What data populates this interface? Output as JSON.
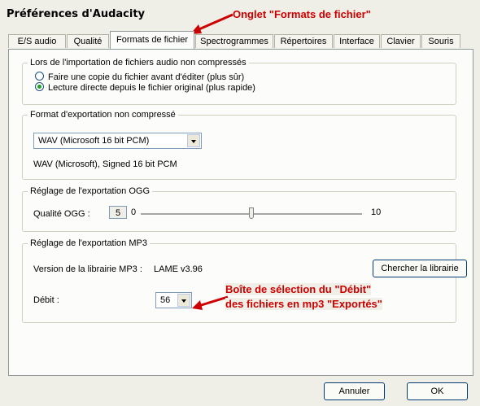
{
  "window": {
    "title": "Préférences d'Audacity"
  },
  "tabs": [
    {
      "label": "E/S audio"
    },
    {
      "label": "Qualité"
    },
    {
      "label": "Formats de fichier"
    },
    {
      "label": "Spectrogrammes"
    },
    {
      "label": "Répertoires"
    },
    {
      "label": "Interface"
    },
    {
      "label": "Clavier"
    },
    {
      "label": "Souris"
    }
  ],
  "active_tab": "Formats de fichier",
  "import_group": {
    "legend": "Lors de l'importation de fichiers audio non compressés",
    "options": [
      {
        "label": "Faire une copie du fichier avant d'éditer (plus sûr)",
        "checked": false
      },
      {
        "label": "Lecture directe depuis le fichier original (plus rapide)",
        "checked": true
      }
    ]
  },
  "export_group": {
    "legend": "Format d'exportation non compressé",
    "format_selected": "WAV (Microsoft 16 bit PCM)",
    "format_description": "WAV (Microsoft), Signed 16 bit PCM"
  },
  "ogg_group": {
    "legend": "Réglage de l'exportation OGG",
    "quality_label": "Qualité OGG :",
    "quality_value": "5",
    "slider_min": "0",
    "slider_max": "10",
    "slider_level": 0.5
  },
  "mp3_group": {
    "legend": "Réglage de l'exportation MP3",
    "library_label": "Version de la librairie MP3 :",
    "library_version": "LAME v3.96",
    "find_library_button": "Chercher la librairie",
    "bitrate_label": "Débit :",
    "bitrate_value": "56"
  },
  "footer": {
    "cancel_button": "Annuler",
    "ok_button": "OK"
  },
  "annotations": {
    "tab_callout": "Onglet \"Formats de fichier\"",
    "bitrate_callout_line1": "Boîte de sélection du \"Débit\"",
    "bitrate_callout_line2": "des fichiers en mp3 \"Exportés\"",
    "color": "#cc0000"
  }
}
